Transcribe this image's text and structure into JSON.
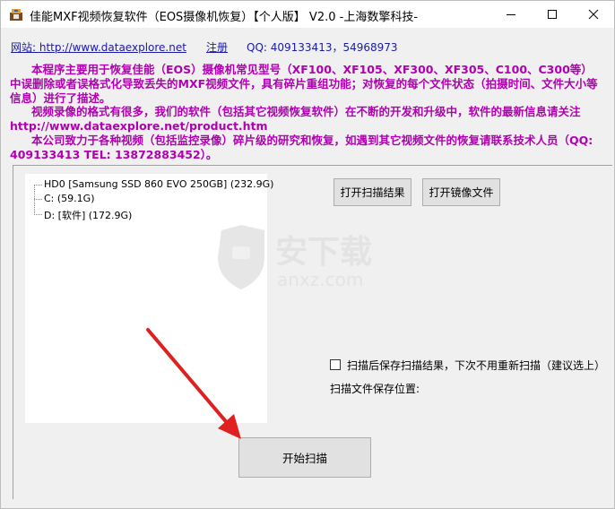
{
  "window": {
    "title": "佳能MXF视频恢复软件（EOS摄像机恢复）【个人版】 V2.0  -上海数擎科技-",
    "minimize_icon": "minimize-icon",
    "maximize_icon": "maximize-icon",
    "close_icon": "close-icon"
  },
  "links": {
    "website": "网站: http://www.dataexplore.net",
    "register": "注册",
    "qq": "QQ: 409133413，54968973"
  },
  "description": {
    "p1": "本程序主要用于恢复佳能（EOS）摄像机常见型号（XF100、XF105、XF300、XF305、C100、C300等）中误删除或者误格式化导致丢失的MXF视频文件，具有碎片重组功能；对恢复的每个文件状态（拍摄时间、文件大小等信息）进行了描述。",
    "p2": "视频录像的格式有很多，我们的软件（包括其它视频恢复软件）在不断的开发和升级中，软件的最新信息请关注 http://www.dataexplore.net/product.htm",
    "p3": "本公司致力于各种视频（包括监控录像）碎片级的研究和恢复，如遇到其它视频文件的恢复请联系技术人员（QQ: 409133413  TEL: 13872883452）。"
  },
  "drives": [
    {
      "label": "HD0   [Samsung SSD 860 EVO 250GB]  (232.9G)"
    },
    {
      "label": "C:     (59.1G)"
    },
    {
      "label": "D:   [软件]  (172.9G)"
    }
  ],
  "buttons": {
    "open_scan_result": "打开扫描结果",
    "open_image_file": "打开镜像文件",
    "start_scan": "开始扫描"
  },
  "options": {
    "save_after_scan_label": "扫描后保存扫描结果，下次不用重新扫描（建议选上）",
    "save_after_scan_checked": false,
    "save_location_label": "扫描文件保存位置:"
  },
  "watermark": {
    "text": "安下载",
    "subtext": "anxz.com"
  },
  "colors": {
    "description": "#b000b0",
    "link": "#1a1aa6",
    "arrow": "#e02020"
  }
}
